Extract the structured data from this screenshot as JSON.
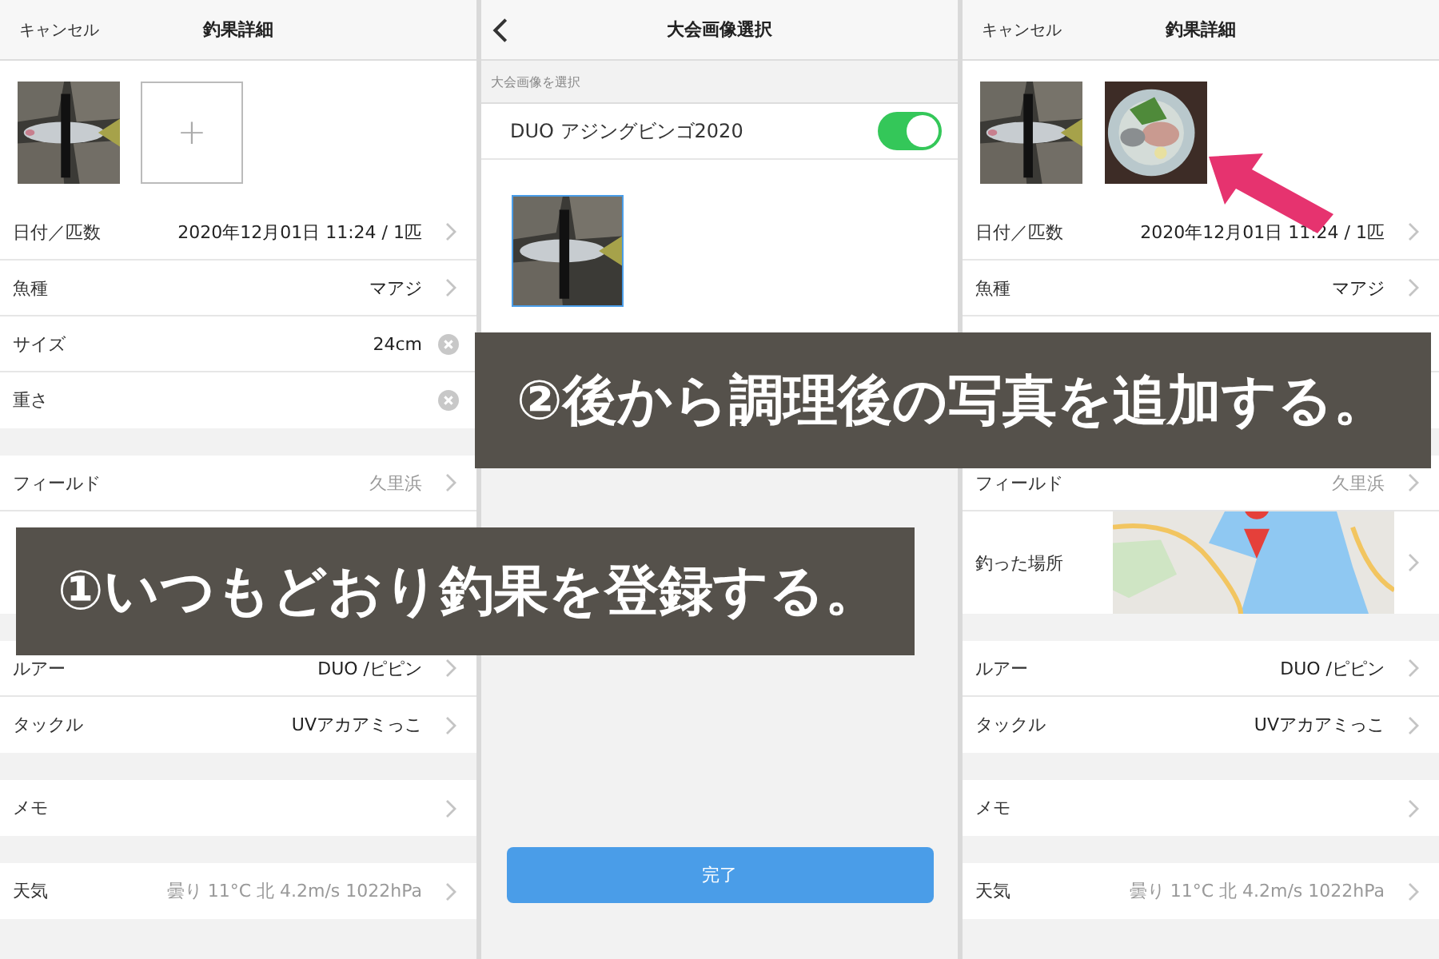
{
  "panels": [
    {
      "kind": "detail",
      "header": {
        "left": "キャンセル",
        "title": "釣果詳細"
      },
      "photos": [
        {
          "kind": "picture"
        },
        {
          "kind": "add",
          "label": "+"
        }
      ],
      "groups": [
        [
          {
            "kind": "chevron",
            "label": "日付／匹数",
            "value": "2020年12月01日 11:24 / 1匹",
            "dim": false
          },
          {
            "kind": "chevron",
            "label": "魚種",
            "value": "マアジ",
            "dim": false
          },
          {
            "kind": "clear",
            "label": "サイズ",
            "value": "24cm",
            "dim": false
          },
          {
            "kind": "clear",
            "label": "重さ"
          }
        ],
        [
          {
            "kind": "chevron",
            "label": "フィールド",
            "value": "久里浜",
            "dim": true
          },
          {
            "kind": "blank"
          }
        ],
        [
          {
            "kind": "chevron",
            "label": "ルアー",
            "value": "DUO /ピピン",
            "dim": false
          },
          {
            "kind": "chevron",
            "label": "タックル",
            "value": "UVアカアミっこ",
            "dim": false
          }
        ],
        [
          {
            "kind": "chevron",
            "label": "メモ"
          }
        ],
        [
          {
            "kind": "chevron",
            "label": "天気",
            "value": "曇り  11°C  北  4.2m/s  1022hPa",
            "dim": true
          }
        ]
      ]
    },
    {
      "kind": "select",
      "header": {
        "title": "大会画像選択"
      },
      "section": "大会画像を選択",
      "toggle": {
        "label": "DUO アジングビンゴ2020",
        "on": true
      },
      "images": [
        {
          "selected": true
        }
      ],
      "button": "完了"
    },
    {
      "kind": "detail",
      "header": {
        "left": "キャンセル",
        "title": "釣果詳細"
      },
      "photos": [
        {
          "kind": "picture"
        },
        {
          "kind": "picture"
        }
      ],
      "groups": [
        [
          {
            "kind": "chevron",
            "label": "日付／匹数",
            "value": "2020年12月01日 11:24 / 1匹",
            "dim": false
          },
          {
            "kind": "chevron",
            "label": "魚種",
            "value": "マアジ",
            "dim": false
          },
          {
            "kind": "empty"
          },
          {
            "kind": "empty"
          }
        ],
        [
          {
            "kind": "chevron",
            "label": "フィールド",
            "value": "久里浜",
            "dim": true
          },
          {
            "kind": "map",
            "label": "釣った場所"
          }
        ],
        [
          {
            "kind": "chevron",
            "label": "ルアー",
            "value": "DUO /ピピン",
            "dim": false
          },
          {
            "kind": "chevron",
            "label": "タックル",
            "value": "UVアカアミっこ",
            "dim": false
          }
        ],
        [
          {
            "kind": "chevron",
            "label": "メモ"
          }
        ],
        [
          {
            "kind": "chevron",
            "label": "天気",
            "value": "曇り  11°C  北  4.2m/s  1022hPa",
            "dim": true
          }
        ]
      ]
    }
  ],
  "captions": [
    {
      "text": "①いつもどおり釣果を登録する。"
    },
    {
      "text": "②後から調理後の写真を追加する。"
    }
  ]
}
